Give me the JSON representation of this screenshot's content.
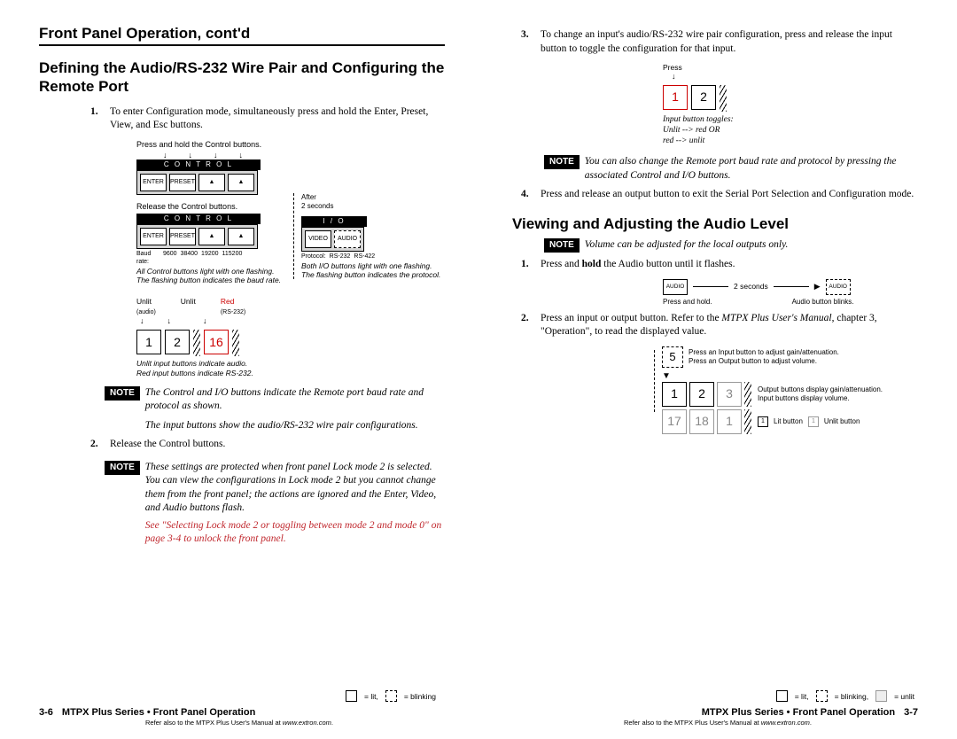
{
  "running_head": "Front Panel Operation, cont'd",
  "left": {
    "section_title": "Defining the Audio/RS-232 Wire Pair and Configuring the Remote Port",
    "step1": "To enter Configuration mode, simultaneously press and hold the Enter, Preset, View, and Esc buttons.",
    "fig1": {
      "press_hold": "Press and hold the Control buttons.",
      "control_label": "C O N T R O L",
      "btns": [
        "ENTER",
        "PRESET",
        "VIEW",
        "ESC"
      ],
      "release": "Release the Control buttons.",
      "after": "After",
      "twosec": "2 seconds",
      "baud_label": "Baud rate:",
      "bauds": [
        "9600",
        "38400",
        "19200",
        "115200"
      ],
      "baud_caption1": "All Control buttons light with one flashing.",
      "baud_caption2": "The flashing button indicates the baud rate.",
      "io_label": "I / O",
      "io_btns": [
        "VIDEO",
        "AUDIO"
      ],
      "proto_label": "Protocol:",
      "protos": [
        "RS-232",
        "RS-422"
      ],
      "io_caption1": "Both I/O buttons light with one flashing.",
      "io_caption2": "The flashing button indicates the protocol.",
      "unlit": "Unlit",
      "audio_small": "(audio)",
      "red": "Red",
      "rs232_small": "(RS-232)",
      "in1": "1",
      "in2": "2",
      "in16": "16",
      "input_caption1": "Unlit input buttons indicate audio.",
      "input_caption2": "Red input buttons indicate RS-232."
    },
    "note1": "The Control and I/O buttons indicate the Remote port baud rate and protocol as shown.",
    "note1b": "The input buttons show the audio/RS-232 wire pair configurations.",
    "step2": "Release the Control buttons.",
    "note2": "These settings are protected when front panel Lock mode 2 is selected. You can view the configurations in Lock mode 2 but you cannot change them from the front panel; the actions are ignored and the Enter, Video, and Audio buttons flash.",
    "crossref": "See \"Selecting Lock mode 2 or toggling between mode 2 and mode 0\" on page 3-4 to unlock the front panel.",
    "legend": {
      "lit": "= lit,",
      "blink": "= blinking"
    }
  },
  "right": {
    "step3": "To change an input's audio/RS-232 wire pair configuration, press and release the input button to toggle the configuration for that input.",
    "fig2": {
      "press": "Press",
      "in1": "1",
      "in2": "2",
      "toggle1": "Input button toggles:",
      "toggle2": "Unlit --> red  OR",
      "toggle3": "red --> unlit"
    },
    "note3": "You can also change the Remote port baud rate and protocol by pressing the associated Control and I/O buttons.",
    "step4": "Press and release an output button to exit the Serial Port Selection and Configuration mode.",
    "section2": "Viewing and Adjusting the Audio Level",
    "note4": "Volume can be adjusted for the local outputs only.",
    "step_b1a": "Press and ",
    "step_b1_hold": "hold",
    "step_b1b": " the Audio button until it flashes.",
    "fig3": {
      "audio": "AUDIO",
      "twosec": "2 seconds",
      "press_hold": "Press and hold.",
      "blinks": "Audio button blinks."
    },
    "step_b2a": "Press an input or output button.  Refer to the ",
    "step_b2_manual": "MTPX Plus User's Manual",
    "step_b2b": ", chapter 3, \"Operation\", to read the displayed value.",
    "fig4": {
      "five": "5",
      "line1": "Press an Input button to adjust gain/attenuation.",
      "line2": "Press an Output button to adjust volume.",
      "r1": [
        "1",
        "2",
        "3"
      ],
      "r2": [
        "17",
        "18",
        "1"
      ],
      "cap1": "Output buttons display gain/attenuation.",
      "cap2": "Input buttons display volume.",
      "lit_label": "Lit button",
      "unlit_label": "Unlit button",
      "one": "1"
    },
    "legend": {
      "lit": "= lit,",
      "blink": "= blinking,",
      "unlit": "= unlit"
    }
  },
  "footer": {
    "left_num": "3-6",
    "right_num": "3-7",
    "title": "MTPX Plus Series • Front Panel Operation",
    "sub_a": "Refer also to the ",
    "sub_b": "MTPX Plus User's Manual ",
    "sub_c": "at ",
    "sub_url": "www.extron.com",
    "sub_d": "."
  },
  "note_label": "NOTE"
}
